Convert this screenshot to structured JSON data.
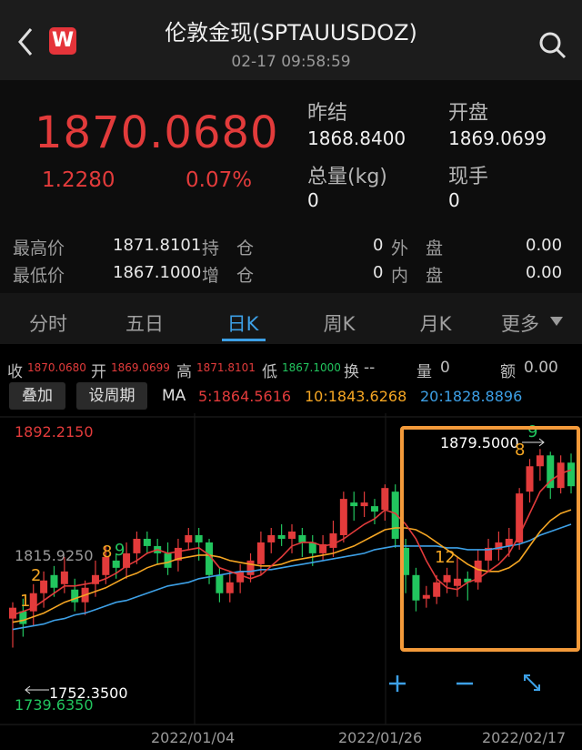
{
  "header": {
    "title": "伦敦金现(SPTAUUSDOZ)",
    "datetime": "02-17 09:58:59",
    "logo_text": "W",
    "icons": [
      "back-icon",
      "search-icon"
    ]
  },
  "quote": {
    "price": "1870.0680",
    "change": "1.2280",
    "change_pct": "0.07%",
    "prev_close_label": "昨结",
    "prev_close": "1868.8400",
    "open_label": "开盘",
    "open": "1869.0699",
    "volume_label": "总量(kg)",
    "volume": "0",
    "current_hand_label": "现手",
    "current_hand": "0"
  },
  "stats": {
    "high_label": "最高价",
    "high": "1871.8101",
    "low_label": "最低价",
    "low": "1867.1000",
    "hold_label": "持　仓",
    "hold": "0",
    "add_label": "增　仓",
    "add": "0",
    "outer_label": "外　盘",
    "outer": "0.00",
    "inner_label": "内　盘",
    "inner": "0.00"
  },
  "tabs": [
    "分时",
    "五日",
    "日K",
    "周K",
    "月K",
    "更多"
  ],
  "active_tab": "日K",
  "ohlc_bar": {
    "close_label": "收",
    "close": "1870.0680",
    "open_label": "开",
    "open": "1869.0699",
    "high_label": "高",
    "high": "1871.8101",
    "low_label": "低",
    "low": "1867.1000",
    "turnover_label": "换",
    "turnover": "--",
    "volume_label": "量",
    "volume": "0",
    "amount_label": "额",
    "amount": "0.00"
  },
  "toolbar": {
    "overlay_label": "叠加",
    "period_label": "设周期",
    "ma_label": "MA",
    "ma5": "5:1864.5616",
    "ma10": "10:1843.6268",
    "ma20": "20:1828.8896"
  },
  "colors": {
    "up": "#e23b3b",
    "down": "#22c55e",
    "ma5": "#e23b3b",
    "ma10": "#f5a623",
    "ma20": "#3da0e6",
    "highlight_box": "#f39a3a",
    "accent": "#3da0e6"
  },
  "chart_data": {
    "type": "candlestick",
    "y_axis_labels": [
      "1892.2150",
      "1815.9250",
      "1739.6350"
    ],
    "x_axis_labels": [
      "2022/01/04",
      "2022/01/26",
      "2022/02/17"
    ],
    "max_marker": "1879.5000",
    "min_marker": "1752.3500",
    "annotations": [
      "1",
      "2",
      "8",
      "9",
      "12",
      "8",
      "9"
    ],
    "ylim": [
      1739.635,
      1892.215
    ],
    "candles": [
      [
        1786,
        1792,
        1770,
        1795
      ],
      [
        1790,
        1783,
        1776,
        1797
      ],
      [
        1790,
        1800,
        1782,
        1805
      ],
      [
        1800,
        1807,
        1792,
        1812
      ],
      [
        1810,
        1803,
        1798,
        1815
      ],
      [
        1805,
        1812,
        1800,
        1820
      ],
      [
        1802,
        1795,
        1790,
        1808
      ],
      [
        1795,
        1803,
        1788,
        1807
      ],
      [
        1805,
        1810,
        1798,
        1818
      ],
      [
        1810,
        1820,
        1805,
        1826
      ],
      [
        1818,
        1814,
        1808,
        1822
      ],
      [
        1814,
        1822,
        1808,
        1828
      ],
      [
        1822,
        1830,
        1816,
        1834
      ],
      [
        1830,
        1826,
        1822,
        1834
      ],
      [
        1826,
        1822,
        1816,
        1830
      ],
      [
        1822,
        1814,
        1810,
        1828
      ],
      [
        1818,
        1825,
        1812,
        1830
      ],
      [
        1828,
        1832,
        1824,
        1836
      ],
      [
        1832,
        1828,
        1818,
        1836
      ],
      [
        1828,
        1810,
        1805,
        1830
      ],
      [
        1810,
        1800,
        1795,
        1814
      ],
      [
        1800,
        1806,
        1795,
        1812
      ],
      [
        1806,
        1812,
        1800,
        1816
      ],
      [
        1810,
        1818,
        1806,
        1822
      ],
      [
        1816,
        1828,
        1810,
        1834
      ],
      [
        1828,
        1832,
        1822,
        1836
      ],
      [
        1832,
        1830,
        1826,
        1838
      ],
      [
        1830,
        1834,
        1822,
        1838
      ],
      [
        1832,
        1828,
        1820,
        1836
      ],
      [
        1828,
        1822,
        1815,
        1832
      ],
      [
        1822,
        1827,
        1818,
        1832
      ],
      [
        1825,
        1833,
        1820,
        1840
      ],
      [
        1832,
        1852,
        1828,
        1856
      ],
      [
        1850,
        1848,
        1840,
        1856
      ],
      [
        1848,
        1850,
        1842,
        1856
      ],
      [
        1848,
        1845,
        1838,
        1852
      ],
      [
        1846,
        1858,
        1840,
        1860
      ],
      [
        1856,
        1830,
        1825,
        1860
      ],
      [
        1825,
        1810,
        1800,
        1830
      ],
      [
        1810,
        1796,
        1790,
        1814
      ],
      [
        1797,
        1799,
        1792,
        1804
      ],
      [
        1798,
        1806,
        1794,
        1810
      ],
      [
        1806,
        1810,
        1800,
        1814
      ],
      [
        1804,
        1808,
        1798,
        1820
      ],
      [
        1808,
        1806,
        1796,
        1812
      ],
      [
        1806,
        1818,
        1802,
        1824
      ],
      [
        1818,
        1825,
        1812,
        1830
      ],
      [
        1824,
        1828,
        1818,
        1834
      ],
      [
        1826,
        1830,
        1820,
        1836
      ],
      [
        1828,
        1855,
        1824,
        1858
      ],
      [
        1856,
        1870,
        1850,
        1874
      ],
      [
        1870,
        1876,
        1862,
        1879.5
      ],
      [
        1876,
        1858,
        1852,
        1878
      ],
      [
        1858,
        1872,
        1855,
        1876
      ],
      [
        1872,
        1859,
        1855,
        1877
      ]
    ],
    "ma5": [
      1788,
      1790,
      1792,
      1796,
      1800,
      1804,
      1804,
      1805,
      1806,
      1808,
      1811,
      1815,
      1818,
      1822,
      1824,
      1822,
      1823,
      1824,
      1825,
      1821,
      1814,
      1812,
      1810,
      1808,
      1810,
      1815,
      1820,
      1826,
      1828,
      1828,
      1826,
      1827,
      1830,
      1834,
      1838,
      1841,
      1846,
      1844,
      1838,
      1830,
      1818,
      1808,
      1803,
      1802,
      1806,
      1808,
      1812,
      1816,
      1822,
      1832,
      1844,
      1856,
      1862,
      1866,
      1868
    ],
    "ma10": [
      1784,
      1785,
      1787,
      1789,
      1792,
      1795,
      1797,
      1799,
      1801,
      1803,
      1806,
      1809,
      1811,
      1814,
      1816,
      1817,
      1819,
      1820,
      1821,
      1821,
      1820,
      1818,
      1817,
      1816,
      1815,
      1815,
      1816,
      1818,
      1819,
      1820,
      1821,
      1822,
      1824,
      1826,
      1829,
      1832,
      1835,
      1836,
      1836,
      1835,
      1832,
      1828,
      1824,
      1820,
      1816,
      1813,
      1812,
      1812,
      1814,
      1818,
      1826,
      1834,
      1840,
      1844,
      1846
    ],
    "ma20": [
      1780,
      1781,
      1782,
      1783,
      1785,
      1786,
      1788,
      1789,
      1791,
      1793,
      1795,
      1796,
      1798,
      1800,
      1802,
      1804,
      1805,
      1806,
      1808,
      1809,
      1810,
      1811,
      1812,
      1812,
      1813,
      1813,
      1814,
      1815,
      1816,
      1817,
      1818,
      1819,
      1820,
      1821,
      1822,
      1824,
      1825,
      1826,
      1826,
      1826,
      1826,
      1826,
      1825,
      1825,
      1824,
      1824,
      1824,
      1825,
      1826,
      1827,
      1829,
      1832,
      1834,
      1836,
      1838
    ]
  }
}
